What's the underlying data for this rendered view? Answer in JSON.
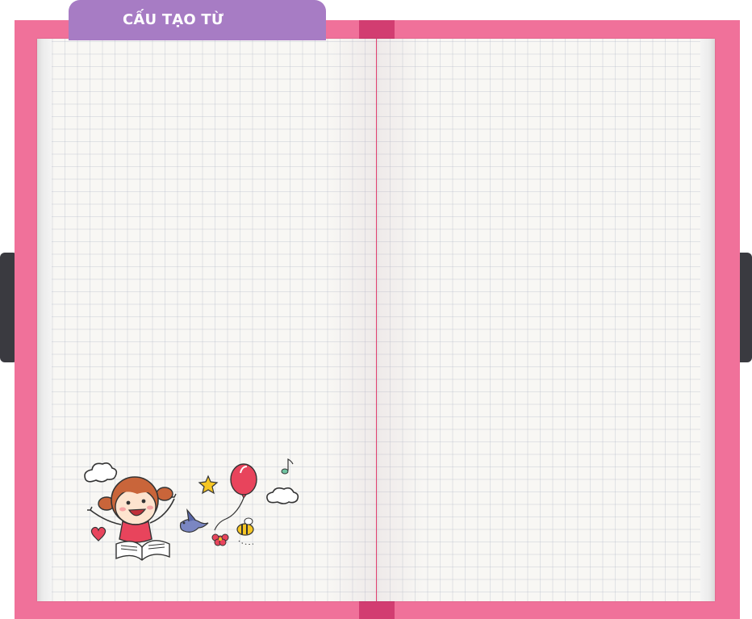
{
  "header": {
    "title": "CẤU TẠO TỪ"
  },
  "colors": {
    "cover": "#f0719a",
    "spine": "#d23d71",
    "tab": "#a77cc4",
    "clasp": "#3a3a40",
    "page": "#f8f7f4"
  },
  "illustration": {
    "icons": [
      "girl-reading-icon",
      "cloud-icon",
      "star-icon",
      "balloon-icon",
      "bird-icon",
      "flower-icon",
      "bee-icon",
      "heart-icon",
      "music-note-icon",
      "book-icon"
    ]
  }
}
